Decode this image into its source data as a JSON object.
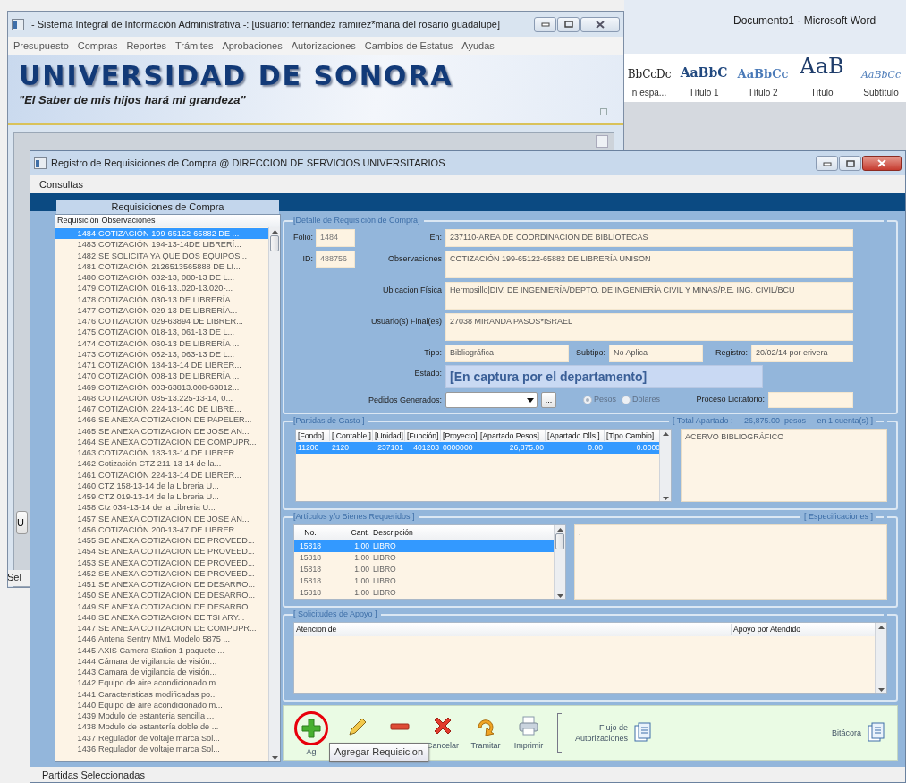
{
  "word_window": {
    "title": "Documento1  -  Microsoft Word",
    "styles": [
      {
        "sample": "BbCcDc",
        "label": "n espa...",
        "kind": "normal"
      },
      {
        "sample": "AaBbC",
        "label": "Título 1",
        "kind": "heading1"
      },
      {
        "sample": "AaBbCc",
        "label": "Título 2",
        "kind": "heading2"
      },
      {
        "sample": "AaB",
        "label": "Título",
        "kind": "title"
      },
      {
        "sample": "AaBbCc",
        "label": "Subtítulo",
        "kind": "subtitle"
      }
    ]
  },
  "main_window": {
    "title": ":- Sistema Integral de Información Administrativa -:  [usuario: fernandez ramirez*maria del rosario guadalupe]",
    "menu": [
      "Presupuesto",
      "Compras",
      "Reportes",
      "Trámites",
      "Aprobaciones",
      "Autorizaciones",
      "Cambios de Estatus",
      "Ayudas"
    ],
    "banner": {
      "title": "UNIVERSIDAD DE SONORA",
      "slogan": "\"El Saber de mis hijos hará mi grandeza\""
    },
    "button_fragment": "U",
    "status_fragment": "Sel"
  },
  "window": {
    "title": "Registro de Requisiciones de Compra @ DIRECCION DE SERVICIOS UNIVERSITARIOS",
    "menu": [
      "Consultas"
    ],
    "requisitions": {
      "title": "Requisiciones de Compra",
      "columns": [
        "Requisición",
        "Observaciones"
      ],
      "rows": [
        {
          "id": "1484",
          "text": "COTIZACIÓN 199-65122-65882 DE ...",
          "selected": true
        },
        {
          "id": "1483",
          "text": "COTIZACIÓN 194-13-14DE LIBRERÍ...",
          "selected": false
        },
        {
          "id": "1482",
          "text": "SE SOLICITA YA QUE DOS EQUIPOS...",
          "selected": false
        },
        {
          "id": "1481",
          "text": "COTIZACIÓN 2126513565888 DE LI...",
          "selected": false
        },
        {
          "id": "1480",
          "text": "COTIZACIÓN 032-13, 080-13 DE L...",
          "selected": false
        },
        {
          "id": "1479",
          "text": "COTIZACIÓN 016-13..020-13.020-...",
          "selected": false
        },
        {
          "id": "1478",
          "text": "COTIZACIÓN 030-13 DE LIBRERÍA ...",
          "selected": false
        },
        {
          "id": "1477",
          "text": "COTIZACIÓN  029-13 DE LIBRERÍA...",
          "selected": false
        },
        {
          "id": "1476",
          "text": "COTIZACIÓN 029-63894 DE LIBRER...",
          "selected": false
        },
        {
          "id": "1475",
          "text": "COTIZACIÓN 018-13, 061-13 DE L...",
          "selected": false
        },
        {
          "id": "1474",
          "text": "COTIZACIÓN 060-13 DE LIBRERÍA ...",
          "selected": false
        },
        {
          "id": "1473",
          "text": "COTIZACIÓN 062-13, 063-13 DE L...",
          "selected": false
        },
        {
          "id": "1471",
          "text": "COTIZACIÓN 184-13-14 DE LIBRER...",
          "selected": false
        },
        {
          "id": "1470",
          "text": "COTIZACIÓN 008-13 DE LIBRERÍA ...",
          "selected": false
        },
        {
          "id": "1469",
          "text": "COTIZACIÓN 003-63813.008-63812...",
          "selected": false
        },
        {
          "id": "1468",
          "text": "COTIZACIÓN 085-13.225-13-14, 0...",
          "selected": false
        },
        {
          "id": "1467",
          "text": "COTIZACIÓN 224-13-14C DE LIBRE...",
          "selected": false
        },
        {
          "id": "1466",
          "text": "SE ANEXA COTIZACION DE PAPELER...",
          "selected": false
        },
        {
          "id": "1465",
          "text": "SE ANEXA COTIZACION DE JOSE AN...",
          "selected": false
        },
        {
          "id": "1464",
          "text": "SE ANEXA COTIZACION DE COMPUPR...",
          "selected": false
        },
        {
          "id": "1463",
          "text": "COTIZACIÓN 183-13-14 DE LIBRER...",
          "selected": false
        },
        {
          "id": "1462",
          "text": "Cotización CTZ 211-13-14 de la...",
          "selected": false
        },
        {
          "id": "1461",
          "text": "COTIZACIÓN 224-13-14 DE LIBRER...",
          "selected": false
        },
        {
          "id": "1460",
          "text": "CTZ 158-13-14 de la Libreria U...",
          "selected": false
        },
        {
          "id": "1459",
          "text": "CTZ 019-13-14 de la Libreria U...",
          "selected": false
        },
        {
          "id": "1458",
          "text": "Ctz 034-13-14 de la Libreria U...",
          "selected": false
        },
        {
          "id": "1457",
          "text": "SE ANEXA COTIZACION DE JOSE AN...",
          "selected": false
        },
        {
          "id": "1456",
          "text": "COTIZACIÓN 200-13-47 DE LIBRER...",
          "selected": false
        },
        {
          "id": "1455",
          "text": "SE ANEXA COTIZACION DE PROVEED...",
          "selected": false
        },
        {
          "id": "1454",
          "text": "SE ANEXA COTIZACION DE PROVEED...",
          "selected": false
        },
        {
          "id": "1453",
          "text": "SE ANEXA COTIZACION DE PROVEED...",
          "selected": false
        },
        {
          "id": "1452",
          "text": "SE ANEXA COTIZACION DE PROVEED...",
          "selected": false
        },
        {
          "id": "1451",
          "text": "SE ANEXA COTIZACION DE DESARRO...",
          "selected": false
        },
        {
          "id": "1450",
          "text": "SE ANEXA COTIZACION DE DESARRO...",
          "selected": false
        },
        {
          "id": "1449",
          "text": "SE ANEXA COTIZACION DE DESARRO...",
          "selected": false
        },
        {
          "id": "1448",
          "text": "SE ANEXA COTIZACION DE TSI ARY...",
          "selected": false
        },
        {
          "id": "1447",
          "text": "SE ANEXA COTIZACION DE COMPUPR...",
          "selected": false
        },
        {
          "id": "1446",
          "text": "Antena Sentry MM1 Modelo 5875 ...",
          "selected": false
        },
        {
          "id": "1445",
          "text": "AXIS Camera Station 1 paquete ...",
          "selected": false
        },
        {
          "id": "1444",
          "text": "Cámara de vigilancia de visión...",
          "selected": false
        },
        {
          "id": "1443",
          "text": "Camara de vigilancia de visión...",
          "selected": false
        },
        {
          "id": "1442",
          "text": "Equipo de aire acondicionado m...",
          "selected": false
        },
        {
          "id": "1441",
          "text": "Caracteristicas modificadas po...",
          "selected": false
        },
        {
          "id": "1440",
          "text": "Equipo de aire acondicionado m...",
          "selected": false
        },
        {
          "id": "1439",
          "text": "Modulo de estanteria sencilla ...",
          "selected": false
        },
        {
          "id": "1438",
          "text": "Modulo de estantería doble de ...",
          "selected": false
        },
        {
          "id": "1437",
          "text": "Regulador de voltaje marca Sol...",
          "selected": false
        },
        {
          "id": "1436",
          "text": "Regulador de voltaje marca Sol...",
          "selected": false
        }
      ]
    },
    "detail": {
      "legend": "[Detalle de Requisición de Compra]",
      "folio": {
        "label": "Folio:",
        "value": "1484"
      },
      "id": {
        "label": "ID:",
        "value": "488756"
      },
      "fields": [
        {
          "label": "En:",
          "value": "237110-AREA DE COORDINACION DE BIBLIOTECAS",
          "kind": "line"
        },
        {
          "label": "Observaciones",
          "value": "COTIZACIÓN 199-65122-65882 DE LIBRERÍA UNISON",
          "kind": "area"
        },
        {
          "label": "Ubicacion Física",
          "value": "Hermosillo|DIV. DE INGENIERÍA/DEPTO. DE INGENIERÍA CIVIL Y MINAS/P.E. ING. CIVIL/BCU",
          "kind": "area"
        },
        {
          "label": "Usuario(s) Final(es)",
          "value": "27038 MIRANDA PASOS*ISRAEL",
          "kind": "area"
        }
      ],
      "tipo": {
        "label": "Tipo:",
        "value": "Bibliográfica"
      },
      "subtipo": {
        "label": "Subtipo:",
        "value": "No Aplica"
      },
      "registro": {
        "label": "Registro:",
        "value": "20/02/14 por erivera"
      },
      "estado": {
        "label": "Estado:",
        "value": "[En captura por el departamento]"
      },
      "pedidos": {
        "label": "Pedidos Generados:",
        "button": "..."
      },
      "currency": [
        {
          "label": "Pesos",
          "selected": true
        },
        {
          "label": "Dólares",
          "selected": false
        }
      ],
      "proceso": {
        "label": "Proceso Licitatorio:"
      }
    },
    "partidas": {
      "legend": "[Partidas de Gasto ]",
      "total": "[ Total Apartado :     26,875.00  pesos     en 1 cuenta(s) ]",
      "columns": [
        "[Fondo]",
        "[ Contable ]",
        "[Unidad]",
        "[Función]",
        "[Proyecto]",
        "[Apartado Pesos]",
        "[Apartado Dlls.]",
        "[Tipo Cambio]"
      ],
      "rows": [
        {
          "cells": [
            "11200",
            "2120",
            "237101",
            "401203",
            "0000000",
            "26,875.00",
            "0.00",
            "0.0000"
          ],
          "selected": true
        }
      ],
      "note": "ACERVO BIBLIOGRÁFICO"
    },
    "articulos": {
      "legend": "[Artículos y/o Bienes Requeridos ]",
      "spec_legend": "[ Especificaciones ]",
      "spec_text": ".",
      "columns": [
        "No.",
        "Cant.",
        "Descripción"
      ],
      "rows": [
        {
          "cells": [
            "15818",
            "1.00",
            "LIBRO"
          ],
          "selected": true
        },
        {
          "cells": [
            "15818",
            "1.00",
            "LIBRO"
          ],
          "selected": false
        },
        {
          "cells": [
            "15818",
            "1.00",
            "LIBRO"
          ],
          "selected": false
        },
        {
          "cells": [
            "15818",
            "1.00",
            "LIBRO"
          ],
          "selected": false
        },
        {
          "cells": [
            "15818",
            "1.00",
            "LIBRO"
          ],
          "selected": false
        }
      ]
    },
    "solicitudes": {
      "legend": "[ Solicitudes de Apoyo ]",
      "columns": [
        "Atencion de",
        "Apoyo por Atendido"
      ]
    },
    "toolbar": {
      "buttons": [
        {
          "kind": "add",
          "label": "Ag",
          "highlighted": true
        },
        {
          "kind": "edit",
          "highlighted": false
        },
        {
          "kind": "remove",
          "highlighted": false
        },
        {
          "kind": "cancel",
          "label": "Cancelar",
          "highlighted": false
        },
        {
          "kind": "process",
          "label": "Tramitar",
          "highlighted": false
        },
        {
          "kind": "print",
          "label": "Imprimir",
          "highlighted": false
        }
      ],
      "flow": "Flujo de Autorizaciones",
      "log": "Bitácora"
    },
    "tooltip": "Agregar Requisicion",
    "status_bar": "Partidas Seleccionadas"
  }
}
